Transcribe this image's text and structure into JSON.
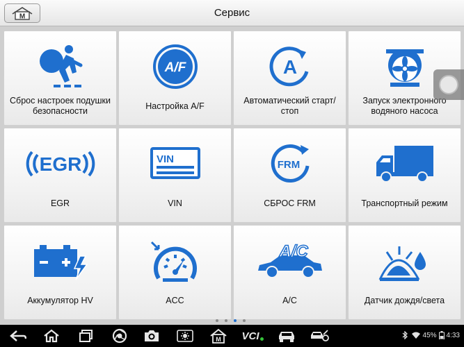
{
  "header": {
    "title": "Сервис",
    "home_button_letter": "M"
  },
  "tiles": [
    {
      "label": "Сброс настроек подушки безопасности",
      "icon": "airbag-icon"
    },
    {
      "label": "Настройка A/F",
      "icon": "af-icon",
      "icon_text": "A/F"
    },
    {
      "label": "Автоматический старт/стоп",
      "icon": "auto-start-stop-icon",
      "icon_text": "A"
    },
    {
      "label": "Запуск электронного водяного насоса",
      "icon": "water-pump-icon"
    },
    {
      "label": "EGR",
      "icon": "egr-icon",
      "icon_text": "EGR"
    },
    {
      "label": "VIN",
      "icon": "vin-icon",
      "icon_text": "VIN"
    },
    {
      "label": "СБРОС FRM",
      "icon": "frm-icon",
      "icon_text": "FRM"
    },
    {
      "label": "Транспортный режим",
      "icon": "truck-icon"
    },
    {
      "label": "Аккумулятор HV",
      "icon": "battery-hv-icon",
      "icon_text_minus": "−",
      "icon_text_plus": "+"
    },
    {
      "label": "ACC",
      "icon": "acc-speedometer-icon"
    },
    {
      "label": "A/C",
      "icon": "ac-car-icon",
      "icon_text": "A/C"
    },
    {
      "label": "Датчик дождя/света",
      "icon": "rain-light-sensor-icon"
    }
  ],
  "pagination": {
    "pages": 4,
    "active": 2
  },
  "navbar": {
    "vci_label": "VCI",
    "m_label": "M",
    "battery": "45%",
    "time": "4:33"
  },
  "colors": {
    "accent": "#1e6fd0",
    "icon_blue": "#1f6fce"
  }
}
